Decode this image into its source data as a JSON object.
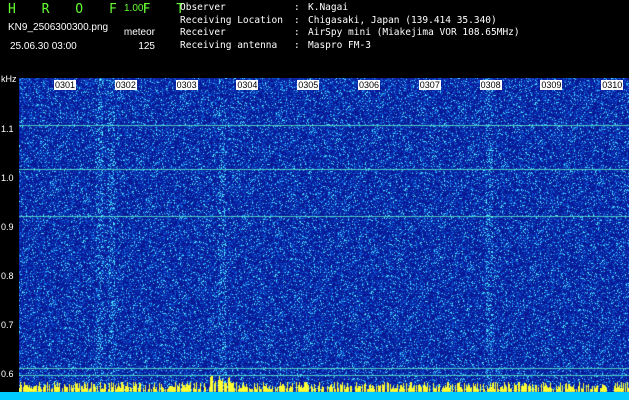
{
  "header": {
    "app_title": "H R O F F T",
    "version": "1.00f",
    "file_name": "KN9_2506300300.png",
    "mode": "meteor",
    "datetime": "25.06.30 03:00",
    "count": "125"
  },
  "info": {
    "rows": [
      {
        "label": "Observer",
        "sep": ":",
        "value": "K.Nagai"
      },
      {
        "label": "Receiving Location",
        "sep": ":",
        "value": "Chigasaki, Japan (139.414 35.340)"
      },
      {
        "label": "Receiver",
        "sep": ":",
        "value": "AirSpy mini (Miakejima VOR 108.65MHz)"
      },
      {
        "label": "Receiving antenna",
        "sep": ":",
        "value": "Maspro FM-3"
      }
    ]
  },
  "chart_data": {
    "type": "heatmap",
    "ylabel": "kHz",
    "y_ticks": [
      "1.1",
      "1.0",
      "0.9",
      "0.8",
      "0.7",
      "0.6"
    ],
    "x_ticks": [
      "0301",
      "0302",
      "0303",
      "0304",
      "0305",
      "0306",
      "0307",
      "0308",
      "0309",
      "0310"
    ],
    "horizontal_lines_khz": [
      1.11,
      1.02,
      0.925,
      0.615,
      0.6
    ],
    "colors": {
      "background": "#0a1a9a",
      "noise_high": "#33ddff",
      "peak": "#ffff33",
      "line": "#66ffcc"
    }
  }
}
